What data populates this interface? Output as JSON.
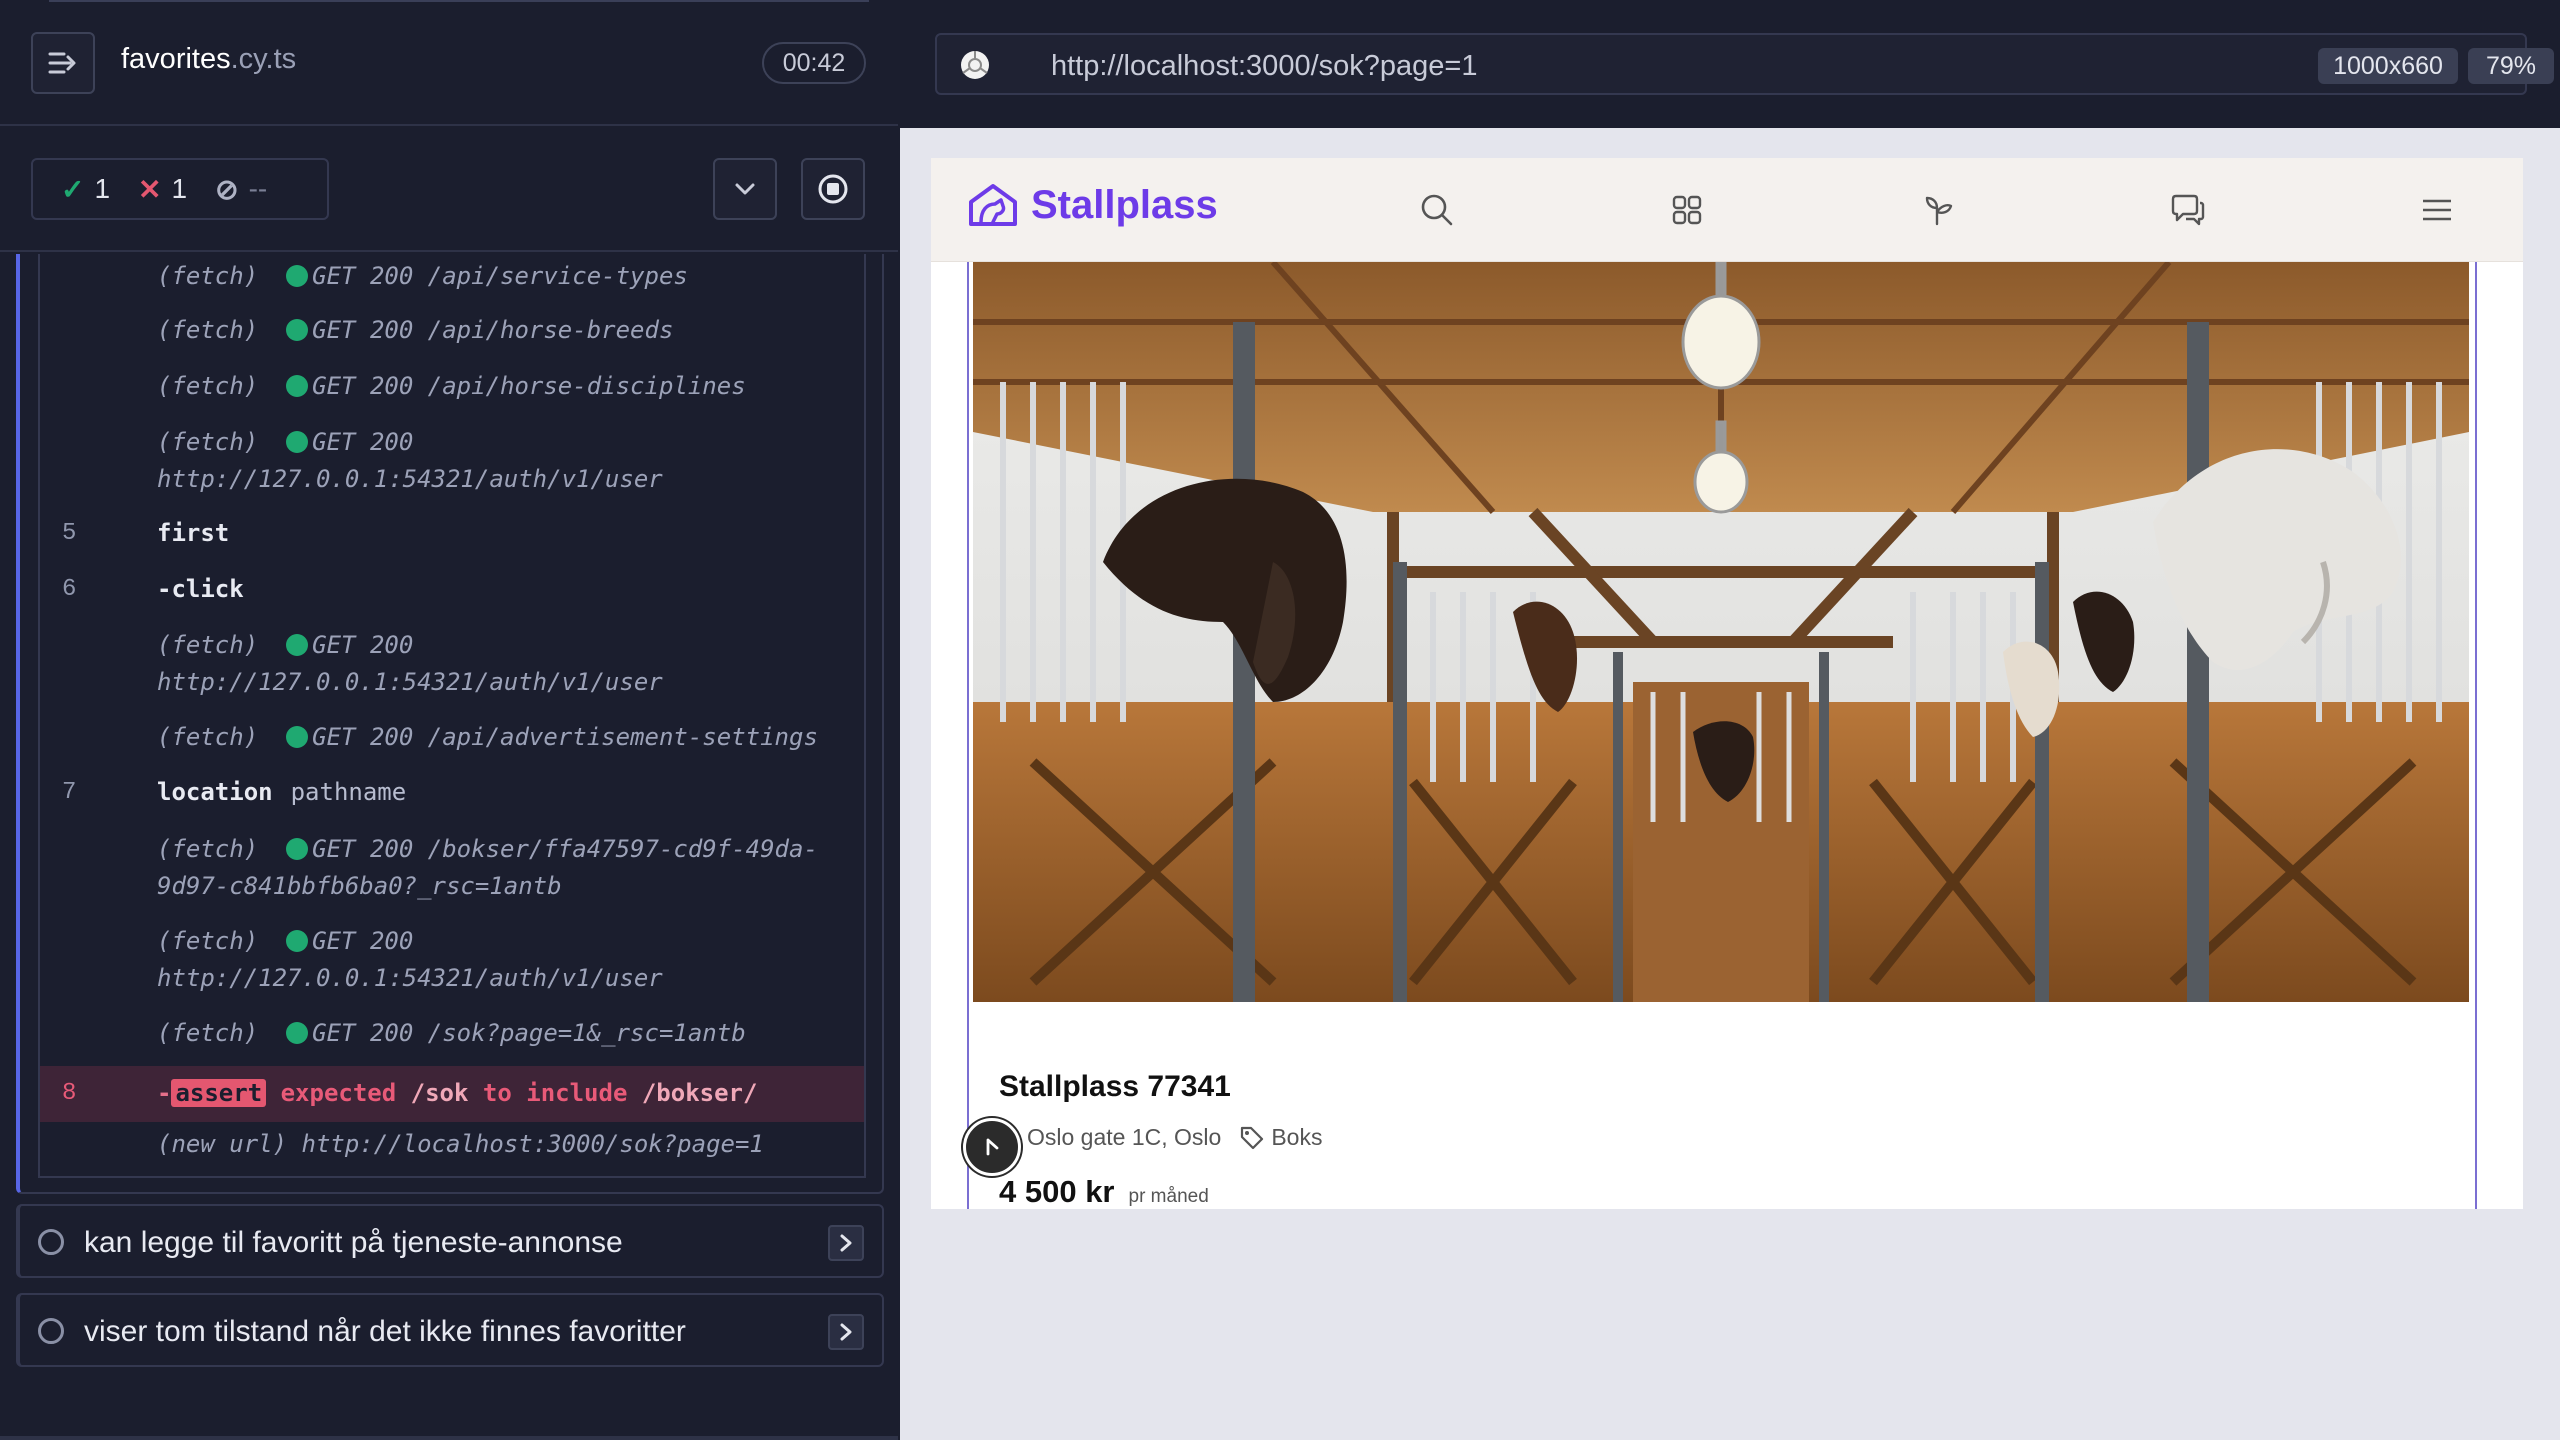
{
  "reporter": {
    "spec_name": "favorites",
    "spec_ext": ".cy.ts",
    "timer": "00:42",
    "stats": {
      "passed": "1",
      "failed": "1",
      "pending": "--"
    }
  },
  "commands": [
    {
      "num": "",
      "method": "(fetch)",
      "status": "GET 200",
      "path": "/api/service-types"
    },
    {
      "num": "",
      "method": "(fetch)",
      "status": "GET 200",
      "path": "/api/horse-breeds"
    },
    {
      "num": "",
      "method": "(fetch)",
      "status": "GET 200",
      "path": "/api/horse-disciplines"
    },
    {
      "num": "",
      "method": "(fetch)",
      "status": "GET 200",
      "path": "http://127.0.0.1:54321/auth/v1/user"
    },
    {
      "num": "5",
      "name": "first",
      "arg": ""
    },
    {
      "num": "6",
      "name": "-click",
      "arg": ""
    },
    {
      "num": "",
      "method": "(fetch)",
      "status": "GET 200",
      "path": "http://127.0.0.1:54321/auth/v1/user"
    },
    {
      "num": "",
      "method": "(fetch)",
      "status": "GET 200",
      "path": "/api/advertisement-settings"
    },
    {
      "num": "7",
      "name": "location",
      "arg": "pathname"
    },
    {
      "num": "",
      "method": "(fetch)",
      "status": "GET 200",
      "path": "/bokser/ffa47597-cd9f-49da-",
      "path2": "9d97-c841bbfb6ba0?_rsc=1antb"
    },
    {
      "num": "",
      "method": "(fetch)",
      "status": "GET 200",
      "path": "http://127.0.0.1:54321/auth/v1/user"
    },
    {
      "num": "",
      "method": "(fetch)",
      "status": "GET 200",
      "path": "/sok?page=1&_rsc=1antb"
    },
    {
      "num": "8",
      "assert": "assert",
      "expected": "expected",
      "actual": "/sok",
      "to_include": "to include",
      "value": "/bokser/"
    },
    {
      "num": "",
      "method": "(new url)",
      "path": "http://localhost:3000/sok?page=1"
    }
  ],
  "tests": [
    {
      "title": "kan legge til favoritt på tjeneste-annonse"
    },
    {
      "title": "viser tom tilstand når det ikke finnes favoritter"
    }
  ],
  "aut": {
    "url": "http://localhost:3000/sok?page=1",
    "viewport": "1000x660",
    "zoom": "79%"
  },
  "site": {
    "logo": "Stallplass",
    "nav_icons": [
      "search-icon",
      "grid-icon",
      "plant-icon",
      "chat-icon",
      "menu-icon"
    ],
    "listing": {
      "title": "Stallplass 77341",
      "address": "Oslo gate 1C, Oslo",
      "tag": "Boks",
      "price": "4 500 kr",
      "per": "pr måned"
    },
    "colors": {
      "brand": "#6d3be8",
      "pass": "#1fa971",
      "fail": "#e45770",
      "active": "#5866e6"
    }
  }
}
